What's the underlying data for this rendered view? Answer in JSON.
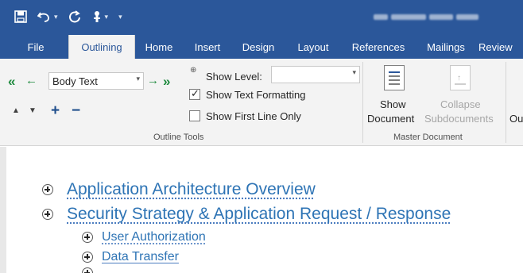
{
  "quick_access": {
    "save_icon": "save-icon",
    "undo_icon": "undo-icon",
    "redo_icon": "repeat-icon",
    "touch_icon": "touch-mode-icon",
    "customize_icon": "customize-qat-icon"
  },
  "tabs": [
    "File",
    "Outlining",
    "Home",
    "Insert",
    "Design",
    "Layout",
    "References",
    "Mailings",
    "Review"
  ],
  "active_tab": "Outlining",
  "outline_tools": {
    "level_value": "Body Text",
    "show_level_label": "Show Level:",
    "show_level_value": "",
    "show_text_formatting_label": "Show Text Formatting",
    "show_text_formatting_checked": true,
    "show_first_line_label": "Show First Line Only",
    "show_first_line_checked": false,
    "group_label": "Outline Tools"
  },
  "master_document": {
    "show_document_line1": "Show",
    "show_document_line2": "Document",
    "collapse_line1": "Collapse",
    "collapse_line2": "Subdocuments",
    "group_label": "Master Document",
    "next_partial": "Ou"
  },
  "outline": [
    {
      "level": 1,
      "text": "Application Architecture Overview"
    },
    {
      "level": 1,
      "text": "Security Strategy & Application Request / Response"
    },
    {
      "level": 2,
      "text": "User Authorization"
    },
    {
      "level": 2,
      "text": "Data Transfer"
    }
  ],
  "colors": {
    "titlebar": "#2b579a",
    "heading": "#2e74b5",
    "ribbon": "#f3f3f3"
  }
}
